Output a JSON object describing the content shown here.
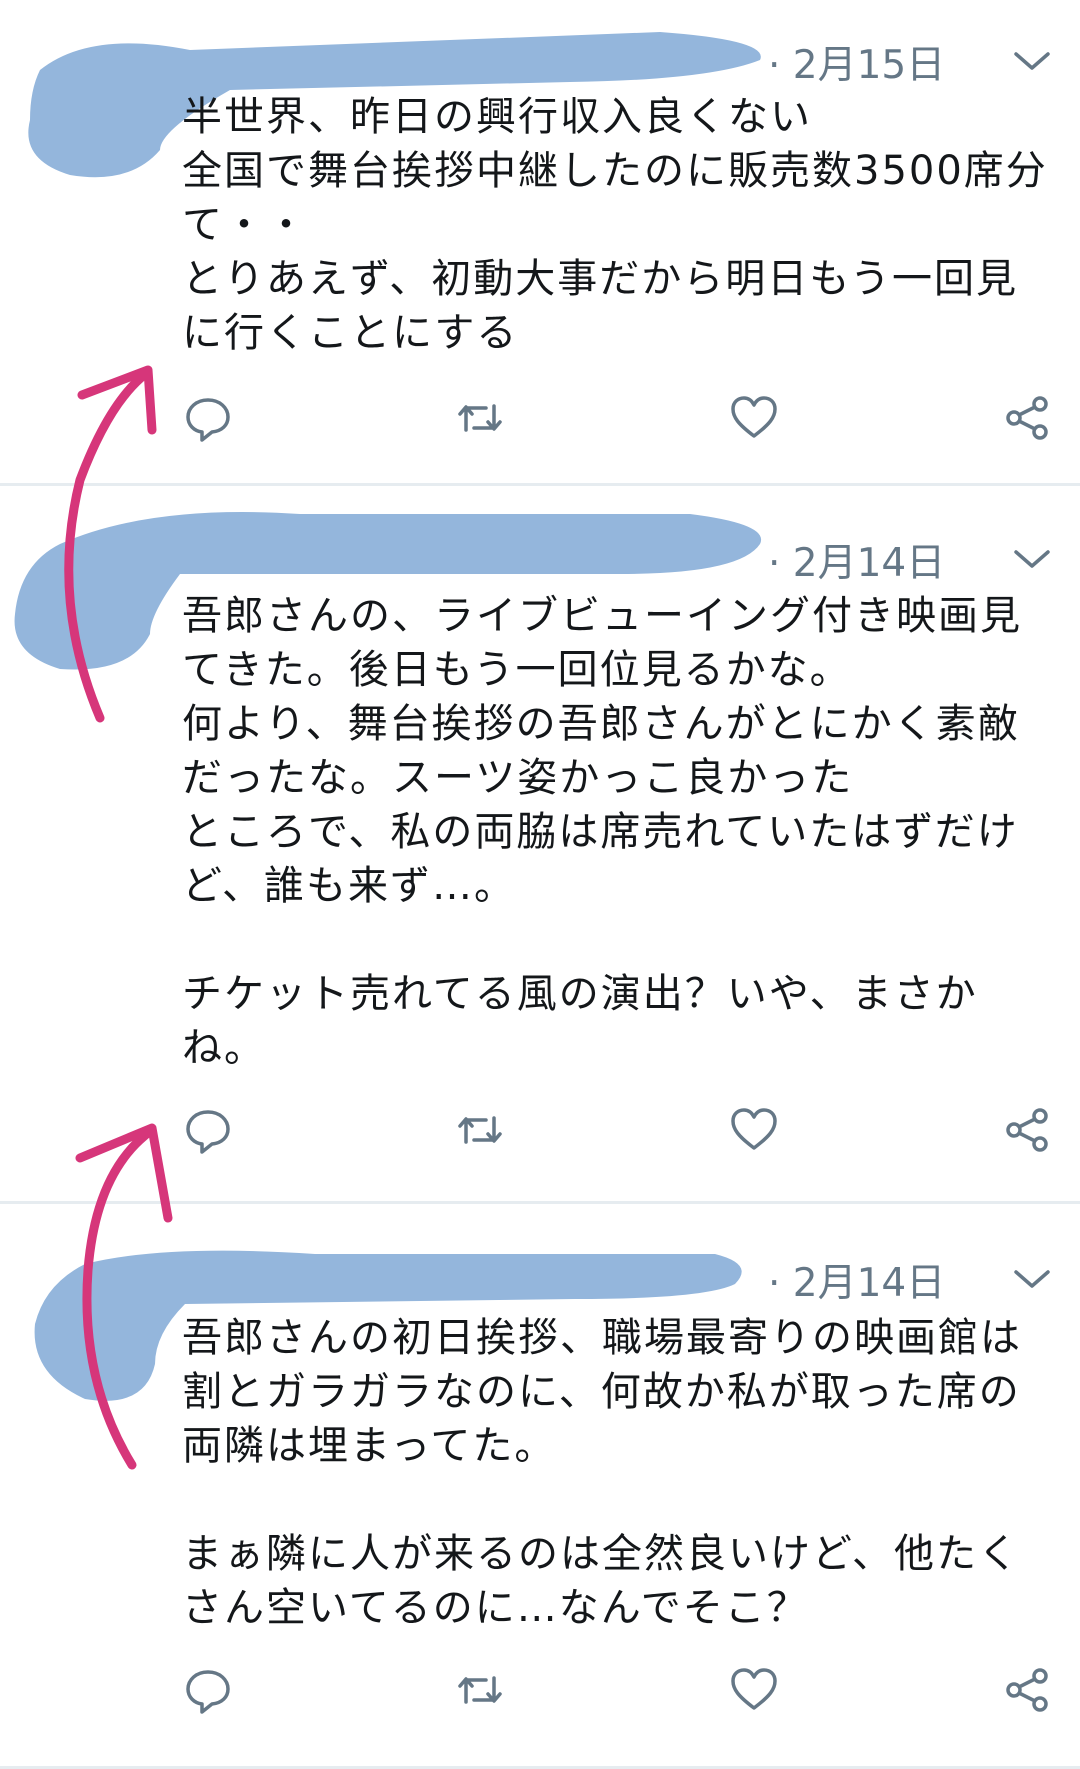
{
  "tweets": [
    {
      "date": "· 2月15日",
      "text": "半世界、昨日の興行収入良くない\n全国で舞台挨拶中継したのに販売数3500席分て・・\nとりあえず、初動大事だから明日もう一回見に行くことにする"
    },
    {
      "date": "· 2月14日",
      "text": "吾郎さんの、ライブビューイング付き映画見てきた。後日もう一回位見るかな。\n何より、舞台挨拶の吾郎さんがとにかく素敵だったな。スーツ姿かっこ良かった\nところで、私の両脇は席売れていたはずだけど、誰も来ず…。\n\nチケット売れてる風の演出？いや、まさかね。"
    },
    {
      "date": "· 2月14日",
      "text": "吾郎さんの初日挨拶、職場最寄りの映画館は割とガラガラなのに、何故か私が取った席の両隣は埋まってた。\n\nまぁ隣に人が来るのは全然良いけど、他たくさん空いてるのに…なんでそこ？"
    }
  ],
  "icons": {
    "reply": "reply-icon",
    "retweet": "retweet-icon",
    "like": "heart-icon",
    "share": "share-icon",
    "more": "chevron-down-icon"
  },
  "colors": {
    "text": "#14171a",
    "secondary": "#657786",
    "divider": "#e6ecf0",
    "redaction": "#94b6dc",
    "annotation_arrow": "#d6367a"
  }
}
